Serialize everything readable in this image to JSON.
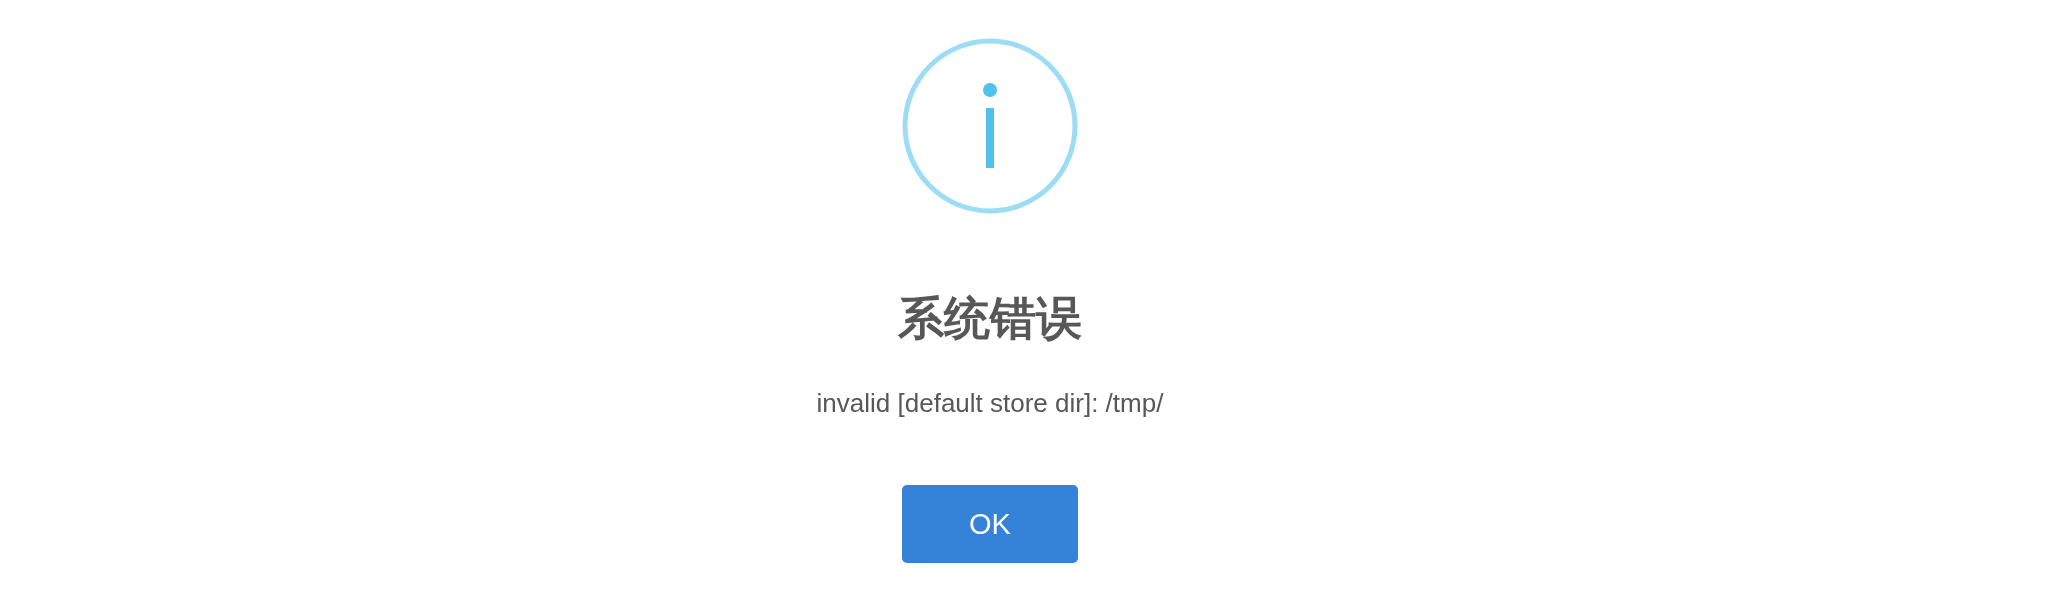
{
  "dialog": {
    "kind": "info",
    "title": "系统错误",
    "message": "invalid [default store dir]: /tmp/",
    "buttons": [
      {
        "label": "OK"
      }
    ]
  }
}
